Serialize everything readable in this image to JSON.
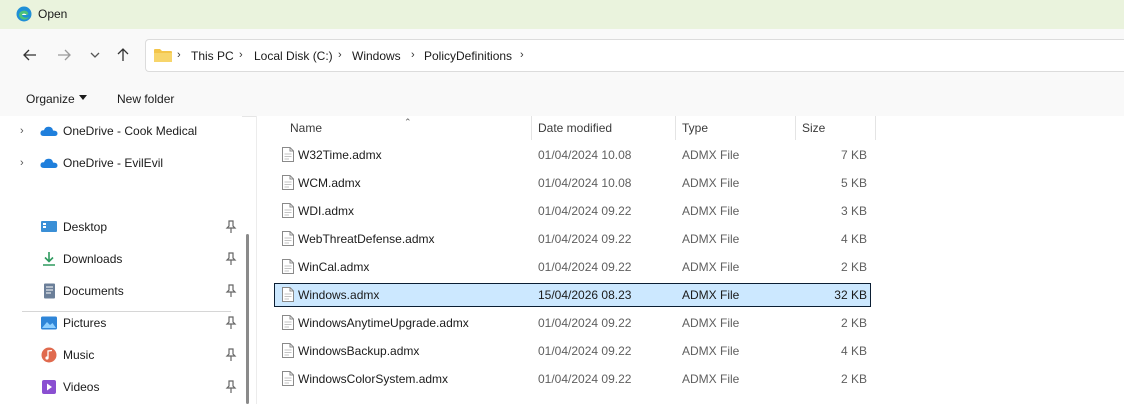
{
  "window": {
    "title": "Open",
    "icon": "edge-browser-icon"
  },
  "nav": {
    "back_icon": "arrow-left-icon",
    "forward_icon": "arrow-right-icon",
    "recent_icon": "chevron-down-icon",
    "up_icon": "arrow-up-icon"
  },
  "address": {
    "crumbs": [
      "This PC",
      "Local Disk (C:)",
      "Windows",
      "PolicyDefinitions"
    ]
  },
  "toolbar": {
    "organize_label": "Organize",
    "new_folder_label": "New folder"
  },
  "sidebar": {
    "onedrive": [
      {
        "label": "OneDrive - Cook Medical",
        "icon": "cloud-icon"
      },
      {
        "label": "OneDrive - EvilEvil",
        "icon": "cloud-icon"
      }
    ],
    "quick_access": [
      {
        "label": "Desktop",
        "icon": "desktop-icon",
        "color": "#3a8fd6"
      },
      {
        "label": "Downloads",
        "icon": "download-icon",
        "color": "#2e9a5e"
      },
      {
        "label": "Documents",
        "icon": "documents-icon",
        "color": "#6b7f99"
      },
      {
        "label": "Pictures",
        "icon": "pictures-icon",
        "color": "#2f86d8"
      },
      {
        "label": "Music",
        "icon": "music-icon",
        "color": "#e06a4e"
      },
      {
        "label": "Videos",
        "icon": "videos-icon",
        "color": "#8a4fd1"
      }
    ]
  },
  "columns": {
    "name": "Name",
    "date": "Date modified",
    "type": "Type",
    "size": "Size"
  },
  "files": [
    {
      "name": "W32Time.admx",
      "date": "01/04/2024 10.08",
      "type": "ADMX File",
      "size": "7 KB"
    },
    {
      "name": "WCM.admx",
      "date": "01/04/2024 10.08",
      "type": "ADMX File",
      "size": "5 KB"
    },
    {
      "name": "WDI.admx",
      "date": "01/04/2024 09.22",
      "type": "ADMX File",
      "size": "3 KB"
    },
    {
      "name": "WebThreatDefense.admx",
      "date": "01/04/2024 09.22",
      "type": "ADMX File",
      "size": "4 KB"
    },
    {
      "name": "WinCal.admx",
      "date": "01/04/2024 09.22",
      "type": "ADMX File",
      "size": "2 KB"
    },
    {
      "name": "Windows.admx",
      "date": "15/04/2026 08.23",
      "type": "ADMX File",
      "size": "32 KB",
      "selected": true
    },
    {
      "name": "WindowsAnytimeUpgrade.admx",
      "date": "01/04/2024 09.22",
      "type": "ADMX File",
      "size": "2 KB"
    },
    {
      "name": "WindowsBackup.admx",
      "date": "01/04/2024 09.22",
      "type": "ADMX File",
      "size": "4 KB"
    },
    {
      "name": "WindowsColorSystem.admx",
      "date": "01/04/2024 09.22",
      "type": "ADMX File",
      "size": "2 KB"
    }
  ],
  "colors": {
    "selection": "#cce8ff",
    "title_bar": "#eaf3dd",
    "folder": "#f3c54a",
    "onedrive": "#1f7fdc"
  }
}
